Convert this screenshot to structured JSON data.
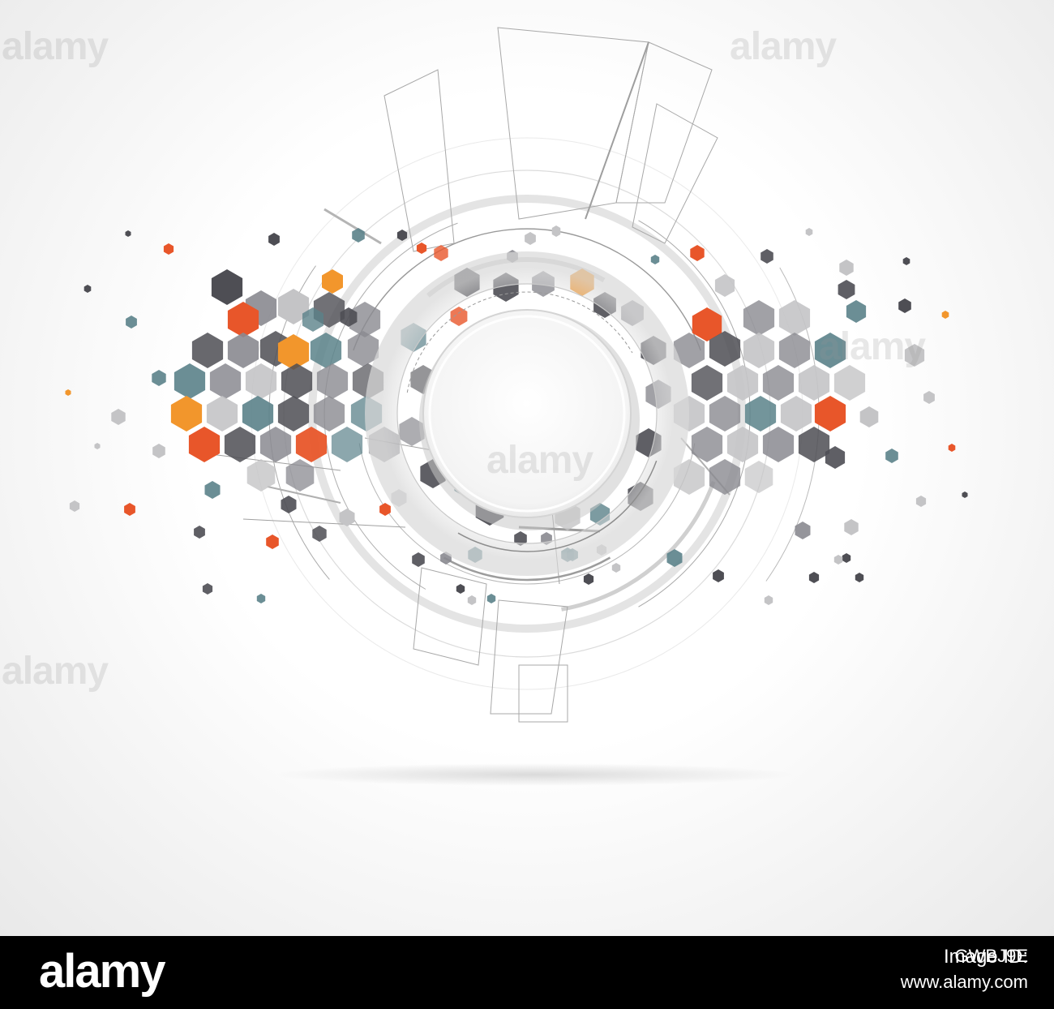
{
  "watermark": {
    "text": "alamy"
  },
  "footer": {
    "logo": "alamy",
    "image_id_label": "Image ID:",
    "image_id": "GWBJ9E",
    "url": "www.alamy.com"
  },
  "colors": {
    "orange_red": "#e8562a",
    "orange": "#f2962c",
    "teal": "#5b828a",
    "dark_gray": "#4e4e54",
    "mid_gray": "#8a8a90",
    "light_gray": "#c4c4c6",
    "line_gray": "#9a9a9a"
  },
  "illustration": {
    "description_icon": "hexagon-technology-circle"
  }
}
